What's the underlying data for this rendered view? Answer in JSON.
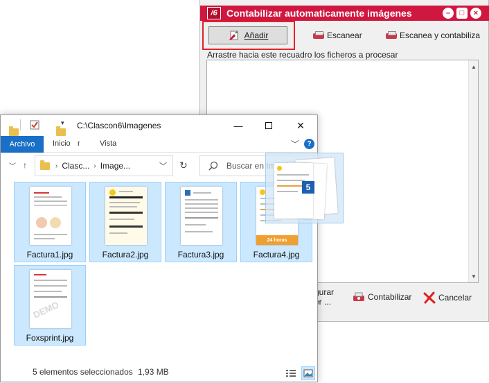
{
  "clascon": {
    "logo": "/6",
    "title": "Contabilizar automaticamente imágenes",
    "window_controls": [
      "–",
      "□",
      "×"
    ],
    "toolbar": {
      "add_label": "Añadir",
      "scan_label": "Escanear",
      "scan_post_label": "Escanea y contabiliza"
    },
    "drop_label": "Arrastre hacia este recuadro los ficheros a procesar",
    "partial_line1": "gurar",
    "partial_line2": "er ...",
    "post_label": "Contabilizar",
    "cancel_label": "Cancelar"
  },
  "explorer": {
    "title_path": "C:\\Clascon6\\Imagenes",
    "ribbon_tabs": [
      "Archivo",
      "Inicio",
      "r",
      "Vista"
    ],
    "address_crumbs": [
      "Clasc...",
      "Image..."
    ],
    "search_placeholder": "Buscar en Imágenes",
    "files": [
      {
        "name": "Factura1.jpg",
        "selected": true
      },
      {
        "name": "Factura2.jpg",
        "selected": true
      },
      {
        "name": "Factura3.jpg",
        "selected": true
      },
      {
        "name": "Factura4.jpg",
        "selected": true
      },
      {
        "name": "Foxsprint.jpg",
        "selected": true
      }
    ],
    "status": {
      "count": "5 elementos seleccionados",
      "size": "1,93 MB"
    },
    "thumb_badges": {
      "factura4_tag": "24 horas",
      "demo_watermark": "DEMO"
    }
  },
  "drag": {
    "count": "5"
  },
  "colors": {
    "clascon_red": "#d0173f",
    "explorer_blue": "#1a6fc7",
    "selection_fill": "#cce8ff",
    "selection_border": "#99d1ff",
    "highlight_box": "#e32227"
  }
}
